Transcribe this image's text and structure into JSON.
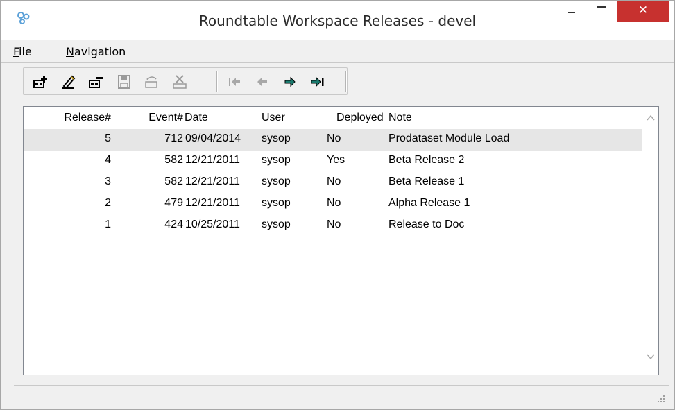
{
  "window": {
    "title": "Roundtable Workspace Releases - devel",
    "app_icon": "roundtable-gears-icon",
    "controls": {
      "minimize": "minimize-icon",
      "maximize": "maximize-icon",
      "close_label": "✕"
    }
  },
  "menu": {
    "file": {
      "accel": "F",
      "rest": "ile"
    },
    "navigation": {
      "accel": "N",
      "rest": "avigation"
    }
  },
  "toolbar": {
    "buttons": [
      {
        "icon": "add-release-icon",
        "enabled": true
      },
      {
        "icon": "edit-release-icon",
        "enabled": true
      },
      {
        "icon": "delete-release-icon",
        "enabled": true
      },
      {
        "icon": "save-icon",
        "enabled": false
      },
      {
        "icon": "undo-icon",
        "enabled": false
      },
      {
        "icon": "cancel-icon",
        "enabled": false
      },
      {
        "icon": "first-record-icon",
        "enabled": false
      },
      {
        "icon": "previous-record-icon",
        "enabled": false
      },
      {
        "icon": "next-record-icon",
        "enabled": true
      },
      {
        "icon": "last-record-icon",
        "enabled": true
      }
    ]
  },
  "grid": {
    "columns": [
      "Release#",
      "Event#",
      "Date",
      "User",
      "Deployed",
      "Note"
    ],
    "rows": [
      {
        "release": "5",
        "event": "712",
        "date": "09/04/2014",
        "user": "sysop",
        "deployed": "No",
        "note": "Prodataset Module Load",
        "selected": true
      },
      {
        "release": "4",
        "event": "582",
        "date": "12/21/2011",
        "user": "sysop",
        "deployed": "Yes",
        "note": "Beta Release 2",
        "selected": false
      },
      {
        "release": "3",
        "event": "582",
        "date": "12/21/2011",
        "user": "sysop",
        "deployed": "No",
        "note": "Beta Release 1",
        "selected": false
      },
      {
        "release": "2",
        "event": "479",
        "date": "12/21/2011",
        "user": "sysop",
        "deployed": "No",
        "note": "Alpha Release 1",
        "selected": false
      },
      {
        "release": "1",
        "event": "424",
        "date": "10/25/2011",
        "user": "sysop",
        "deployed": "No",
        "note": "Release to Doc",
        "selected": false
      }
    ]
  },
  "colors": {
    "close_button": "#c7312f",
    "selected_row": "#e6e6e6",
    "toolbar_arrow_active": "#1a7a6e"
  }
}
